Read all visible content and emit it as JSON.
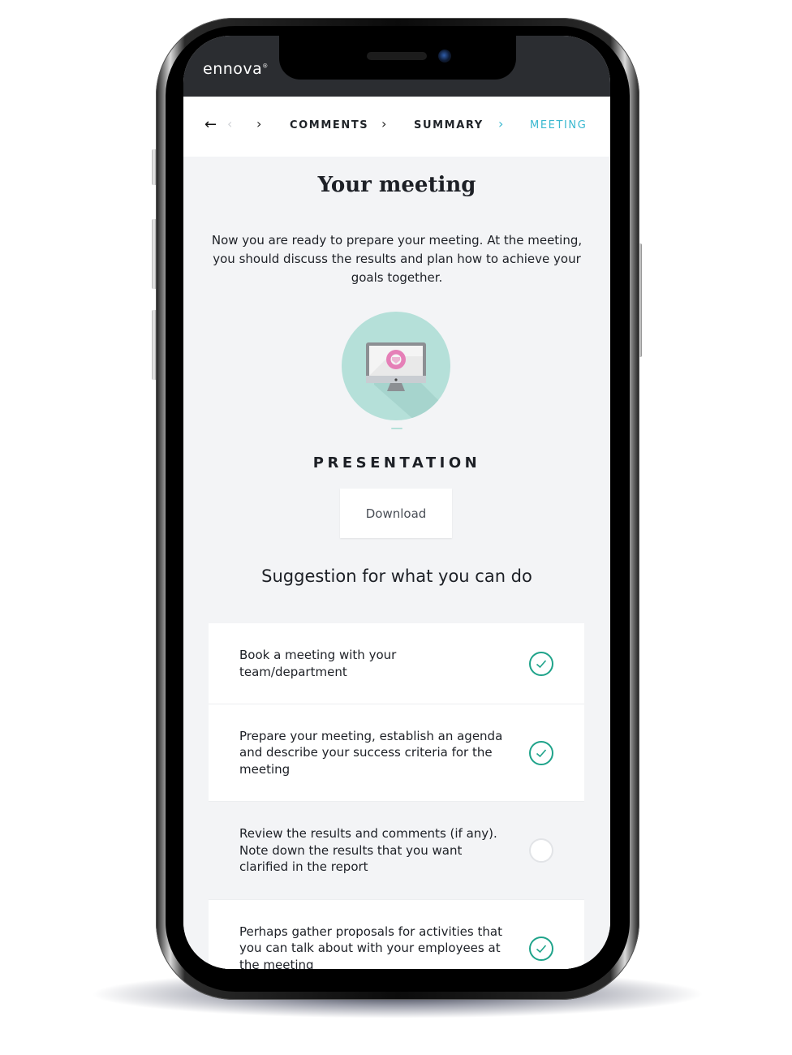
{
  "app": {
    "brand": "ennova",
    "brand_mark": "®"
  },
  "navbar": {
    "back_icon": "arrow-left-icon",
    "steps": [
      {
        "label": "",
        "state": "faded"
      },
      {
        "label": "COMMENTS",
        "state": "done"
      },
      {
        "label": "SUMMARY",
        "state": "done"
      },
      {
        "label": "MEETING",
        "state": "active"
      }
    ],
    "active_color": "#39b8d0"
  },
  "page": {
    "title": "Your meeting",
    "intro": "Now you are ready to prepare your meeting. At the meeting, you should discuss the results and plan how to achieve your goals together.",
    "presentation": {
      "icon": "monitor-presentation-icon",
      "label": "PRESENTATION",
      "download_label": "Download"
    },
    "suggestions_title": "Suggestion for what you can do",
    "suggestions": [
      {
        "text": "Book a meeting with your team/department",
        "checked": true
      },
      {
        "text": "Prepare your meeting, establish an agenda and describe your success criteria for the meeting",
        "checked": true
      },
      {
        "text": "Review the results and comments (if any). Note down the results that you want clarified in the report",
        "checked": false
      },
      {
        "text": "Perhaps gather proposals for activities that you can talk about with your employees at the meeting",
        "checked": true
      }
    ]
  },
  "colors": {
    "check_accent": "#1fa38a",
    "circle_bg": "#b5e0d9",
    "header_dark": "#2b2d31"
  }
}
